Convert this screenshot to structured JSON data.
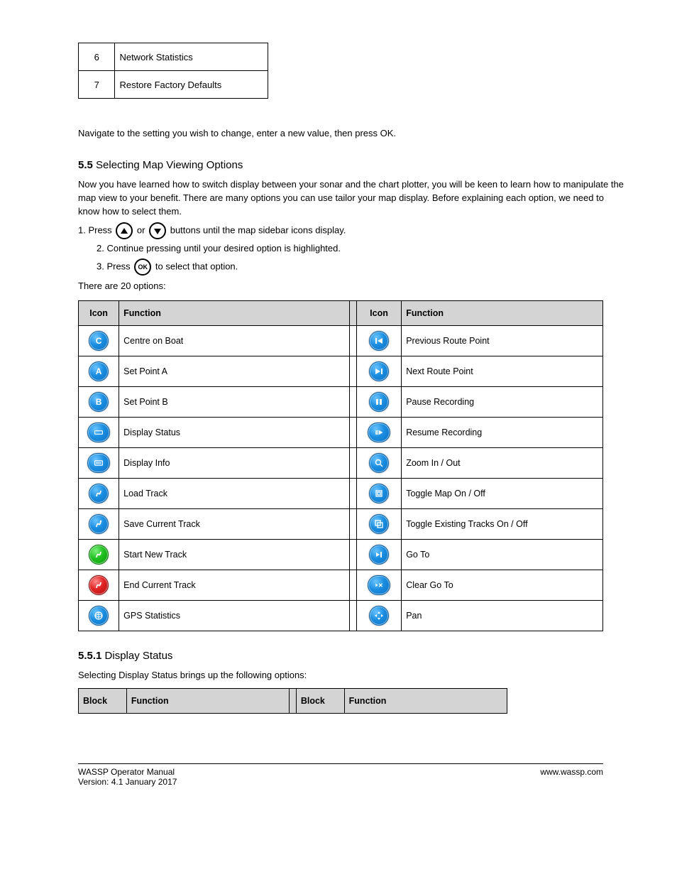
{
  "smallTable": {
    "rows": [
      {
        "num": "6",
        "label": "Network Statistics"
      },
      {
        "num": "7",
        "label": "Restore Factory Defaults"
      }
    ]
  },
  "line1": "Navigate to the setting you wish to change, enter a new value, then press OK.",
  "section5_5": {
    "chapter": "5.5",
    "title": " Selecting Map Viewing Options",
    "p1": "Now you have learned how to switch display between your sonar and the chart plotter, you will be keen to learn how to manipulate the map view to your benefit. There are many options you can use tailor your map display. Before explaining each option, we need to know how to select them.",
    "s1": "1.  Press ",
    "s1b": " or ",
    "s1c": " buttons until the map sidebar icons display.",
    "s2": "2.  Continue pressing until your desired option is highlighted.",
    "s3": "3.  Press ",
    "s3b": " to select that option.",
    "s4": "There are 20 options:"
  },
  "iconsTable": {
    "headers": [
      "Icon",
      "Function",
      "Icon",
      "Function"
    ],
    "rows": [
      {
        "funcA": "Centre on Boat",
        "iconA": "C",
        "funcB": "Previous Route Point",
        "iconB": "prev"
      },
      {
        "funcA": "Set Point A",
        "iconA": "A",
        "funcB": "Next Route Point",
        "iconB": "next"
      },
      {
        "funcA": "Set Point B",
        "iconA": "B",
        "funcB": "Pause Recording",
        "iconB": "pause"
      },
      {
        "funcA": "Display Status",
        "iconA": "status",
        "funcB": "Resume Recording",
        "iconB": "resume"
      },
      {
        "funcA": "Display Info",
        "iconA": "info",
        "funcB": "Zoom In / Out",
        "iconB": "zoom"
      },
      {
        "funcA": "Load Track",
        "iconA": "load",
        "funcB": "Toggle Map On / Off",
        "iconB": "toggle"
      },
      {
        "funcA": "Save Current Track",
        "iconA": "save",
        "funcB": "Toggle Existing Tracks On / Off",
        "iconB": "tracks"
      },
      {
        "funcA": "Start New Track",
        "iconA": "start",
        "iconAColor": "green",
        "funcB": "Go To",
        "iconB": "goto"
      },
      {
        "funcA": "End Current Track",
        "iconA": "end",
        "iconAColor": "red",
        "funcB": "Clear Go To",
        "iconB": "cleargoto"
      },
      {
        "funcA": "GPS Statistics",
        "iconA": "gps",
        "funcB": "Pan",
        "iconB": "pan"
      }
    ]
  },
  "section5_5_1": {
    "chapter": "5.5.1",
    "title": " Display Status",
    "p": "Selecting Display Status brings up the following options:"
  },
  "statusTable": {
    "headers": [
      "Block",
      "Function",
      "Block",
      "Function"
    ]
  },
  "footer": {
    "left": "WASSP Operator Manual",
    "right": "www.wassp.com",
    "sub": "Version: 4.1 January 2017"
  }
}
